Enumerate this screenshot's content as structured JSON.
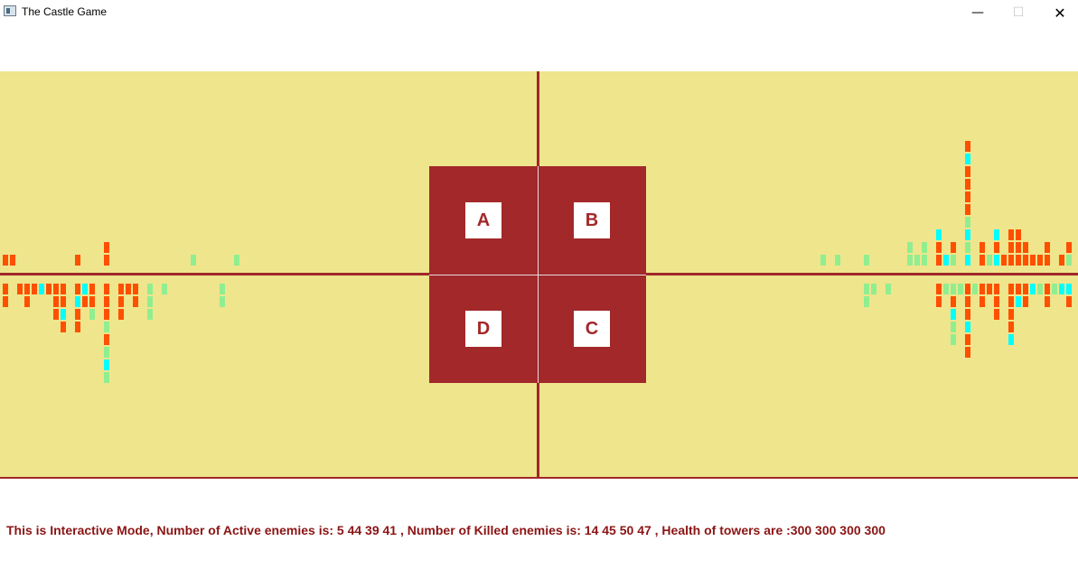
{
  "window": {
    "title": "The Castle Game",
    "icons": {
      "app": "app-window-icon",
      "minimize": "minimize-icon",
      "maximize": "maximize-icon",
      "close": "close-icon"
    }
  },
  "colors": {
    "field": "#efe58c",
    "lines": "#a0282a",
    "castle": "#a2282a",
    "enemy_orange": "#ff4f00",
    "enemy_cyan": "#00ffff",
    "enemy_green": "#90ee90",
    "status_text": "#8b1414"
  },
  "towers": [
    {
      "id": "a",
      "label": "A"
    },
    {
      "id": "b",
      "label": "B"
    },
    {
      "id": "c",
      "label": "C"
    },
    {
      "id": "d",
      "label": "D"
    }
  ],
  "status": {
    "text": "This is Interactive Mode, Number of Active enemies is: 5 44 39 41 , Number of Killed enemies is: 14 45 50 47 , Health of towers are :300 300 300 300"
  }
}
